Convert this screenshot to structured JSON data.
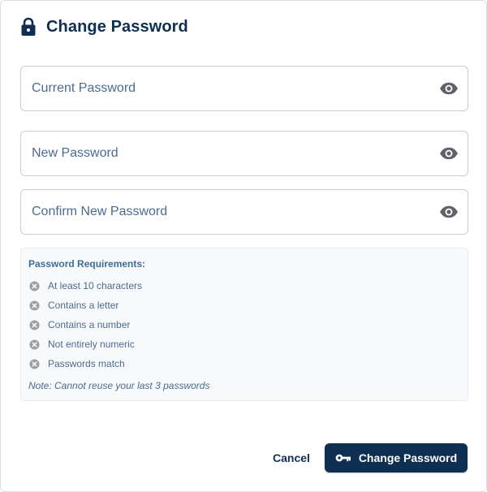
{
  "dialog": {
    "title": "Change Password",
    "title_icon": "lock-icon"
  },
  "fields": {
    "current": {
      "placeholder": "Current Password",
      "value": "",
      "icon": "eye-icon"
    },
    "new": {
      "placeholder": "New Password",
      "value": "",
      "icon": "eye-icon"
    },
    "confirm": {
      "placeholder": "Confirm New Password",
      "value": "",
      "icon": "eye-icon"
    }
  },
  "requirements": {
    "title": "Password Requirements:",
    "items": [
      {
        "label": "At least 10 characters",
        "status": "unmet",
        "icon": "x-circle-icon"
      },
      {
        "label": "Contains a letter",
        "status": "unmet",
        "icon": "x-circle-icon"
      },
      {
        "label": "Contains a number",
        "status": "unmet",
        "icon": "x-circle-icon"
      },
      {
        "label": "Not entirely numeric",
        "status": "unmet",
        "icon": "x-circle-icon"
      },
      {
        "label": "Passwords match",
        "status": "unmet",
        "icon": "x-circle-icon"
      }
    ],
    "note": "Note: Cannot reuse your last 3 passwords"
  },
  "actions": {
    "cancel_label": "Cancel",
    "submit_label": "Change Password",
    "submit_icon": "key-icon"
  },
  "colors": {
    "primary": "#0e2f52",
    "field_border": "#c9ced4",
    "unmet_icon": "#9aa0a6",
    "requirements_bg": "#f8f9fa"
  }
}
